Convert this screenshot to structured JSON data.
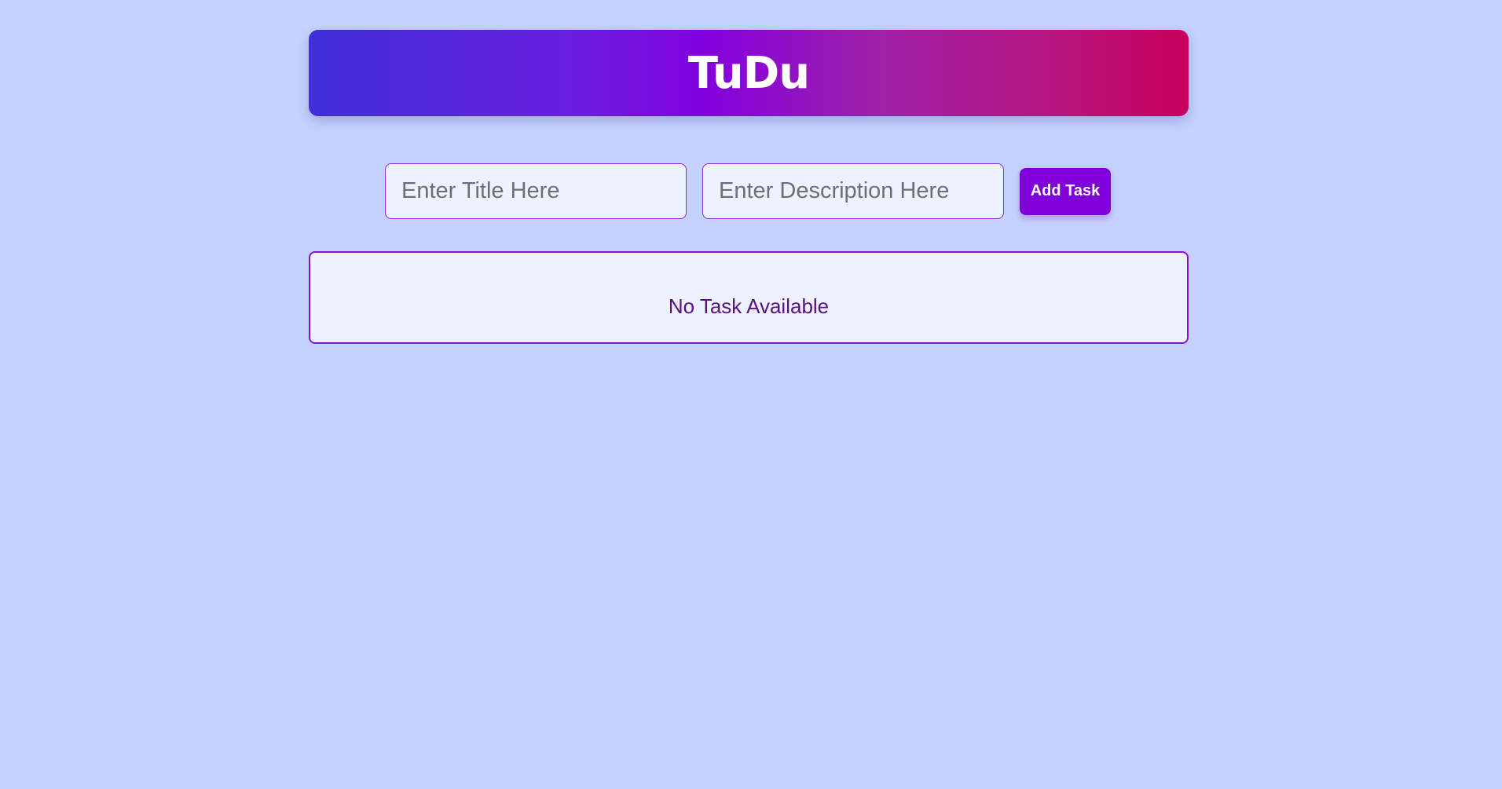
{
  "header": {
    "title": "TuDu"
  },
  "form": {
    "title_placeholder": "Enter Title Here",
    "title_value": "",
    "description_placeholder": "Enter Description Here",
    "description_value": "",
    "add_button_label": "Add Task"
  },
  "tasks": {
    "items": [],
    "empty_message": "No Task Available"
  },
  "colors": {
    "background": "#c5d1fe",
    "accent": "#8000d9",
    "gradient_start": "#3f2fd8",
    "gradient_end": "#c8005c",
    "panel_background": "#eef1fe",
    "empty_text": "#5a1280"
  }
}
